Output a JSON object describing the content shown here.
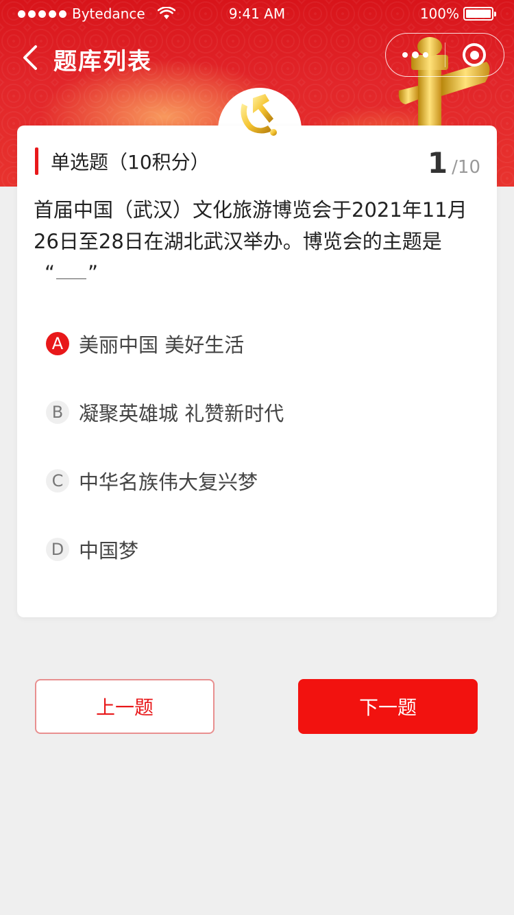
{
  "status_bar": {
    "carrier": "Bytedance",
    "time": "9:41 AM",
    "battery": "100%"
  },
  "nav": {
    "title": "题库列表"
  },
  "question": {
    "type_label": "单选题（10积分）",
    "current": "1",
    "separator": "/",
    "total": "10",
    "text": "首届中国（武汉）文化旅游博览会于2021年11月26日至28日在湖北武汉举办。博览会的主题是",
    "quote_open": "“",
    "quote_close": "”"
  },
  "options": [
    {
      "letter": "A",
      "text": "美丽中国 美好生活",
      "selected": true
    },
    {
      "letter": "B",
      "text": "凝聚英雄城 礼赞新时代",
      "selected": false
    },
    {
      "letter": "C",
      "text": "中华名族伟大复兴梦",
      "selected": false
    },
    {
      "letter": "D",
      "text": "中国梦",
      "selected": false
    }
  ],
  "buttons": {
    "prev": "上一题",
    "next": "下一题"
  },
  "colors": {
    "accent": "#e8181a",
    "next_button": "#f2120f",
    "background": "#efefef"
  }
}
